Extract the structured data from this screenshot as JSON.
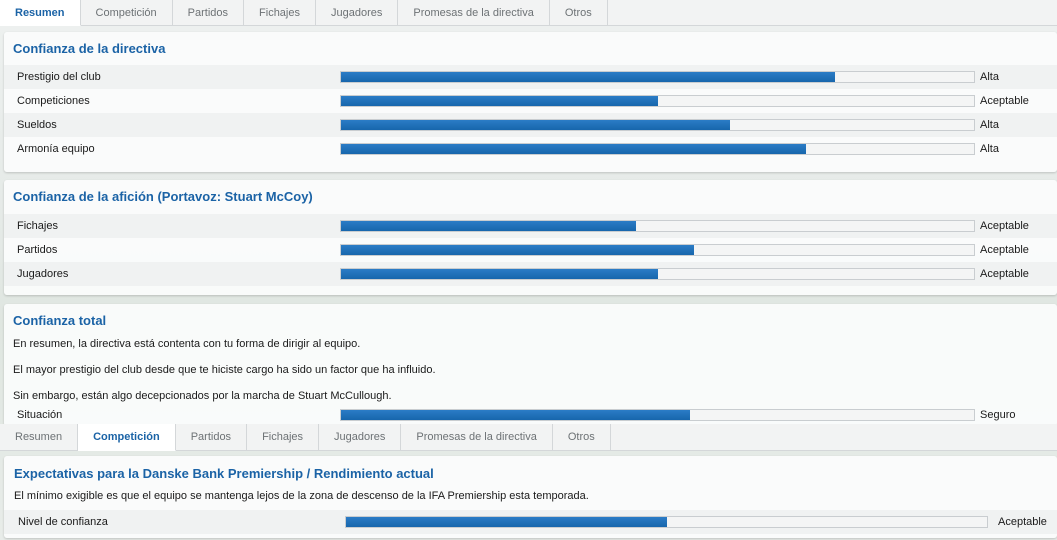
{
  "tabs_top": [
    "Resumen",
    "Competición",
    "Partidos",
    "Fichajes",
    "Jugadores",
    "Promesas de la directiva",
    "Otros"
  ],
  "tabs_bottom": [
    "Resumen",
    "Competición",
    "Partidos",
    "Fichajes",
    "Jugadores",
    "Promesas de la directiva",
    "Otros"
  ],
  "board": {
    "title": "Confianza de la directiva",
    "rows": [
      {
        "label": "Prestigio del club",
        "value": "Alta",
        "level": 0.781
      },
      {
        "label": "Competiciones",
        "value": "Aceptable",
        "level": 0.501
      },
      {
        "label": "Sueldos",
        "value": "Alta",
        "level": 0.614
      },
      {
        "label": "Armonía equipo",
        "value": "Alta",
        "level": 0.734
      }
    ]
  },
  "fans": {
    "title": "Confianza de la afición (Portavoz: Stuart McCoy)",
    "rows": [
      {
        "label": "Fichajes",
        "value": "Aceptable",
        "level": 0.466
      },
      {
        "label": "Partidos",
        "value": "Aceptable",
        "level": 0.558
      },
      {
        "label": "Jugadores",
        "value": "Aceptable",
        "level": 0.501
      }
    ]
  },
  "total": {
    "title": "Confianza total",
    "paragraphs": [
      "En resumen, la directiva está contenta con tu forma de dirigir al equipo.",
      "El mayor prestigio del club desde que te hiciste cargo ha sido un factor que ha influido.",
      "Sin embargo, están algo decepcionados por la marcha de Stuart McCullough."
    ],
    "status": {
      "label": "Situación",
      "value": "Seguro",
      "level": 0.551
    }
  },
  "expectations": {
    "title": "Expectativas para la Danske Bank Premiership / Rendimiento actual",
    "text": "El mínimo exigible es que el equipo se mantenga lejos de la zona de descenso de la IFA Premiership esta temporada.",
    "row": {
      "label": "Nivel de confianza",
      "value": "Aceptable",
      "level": 0.5
    }
  }
}
